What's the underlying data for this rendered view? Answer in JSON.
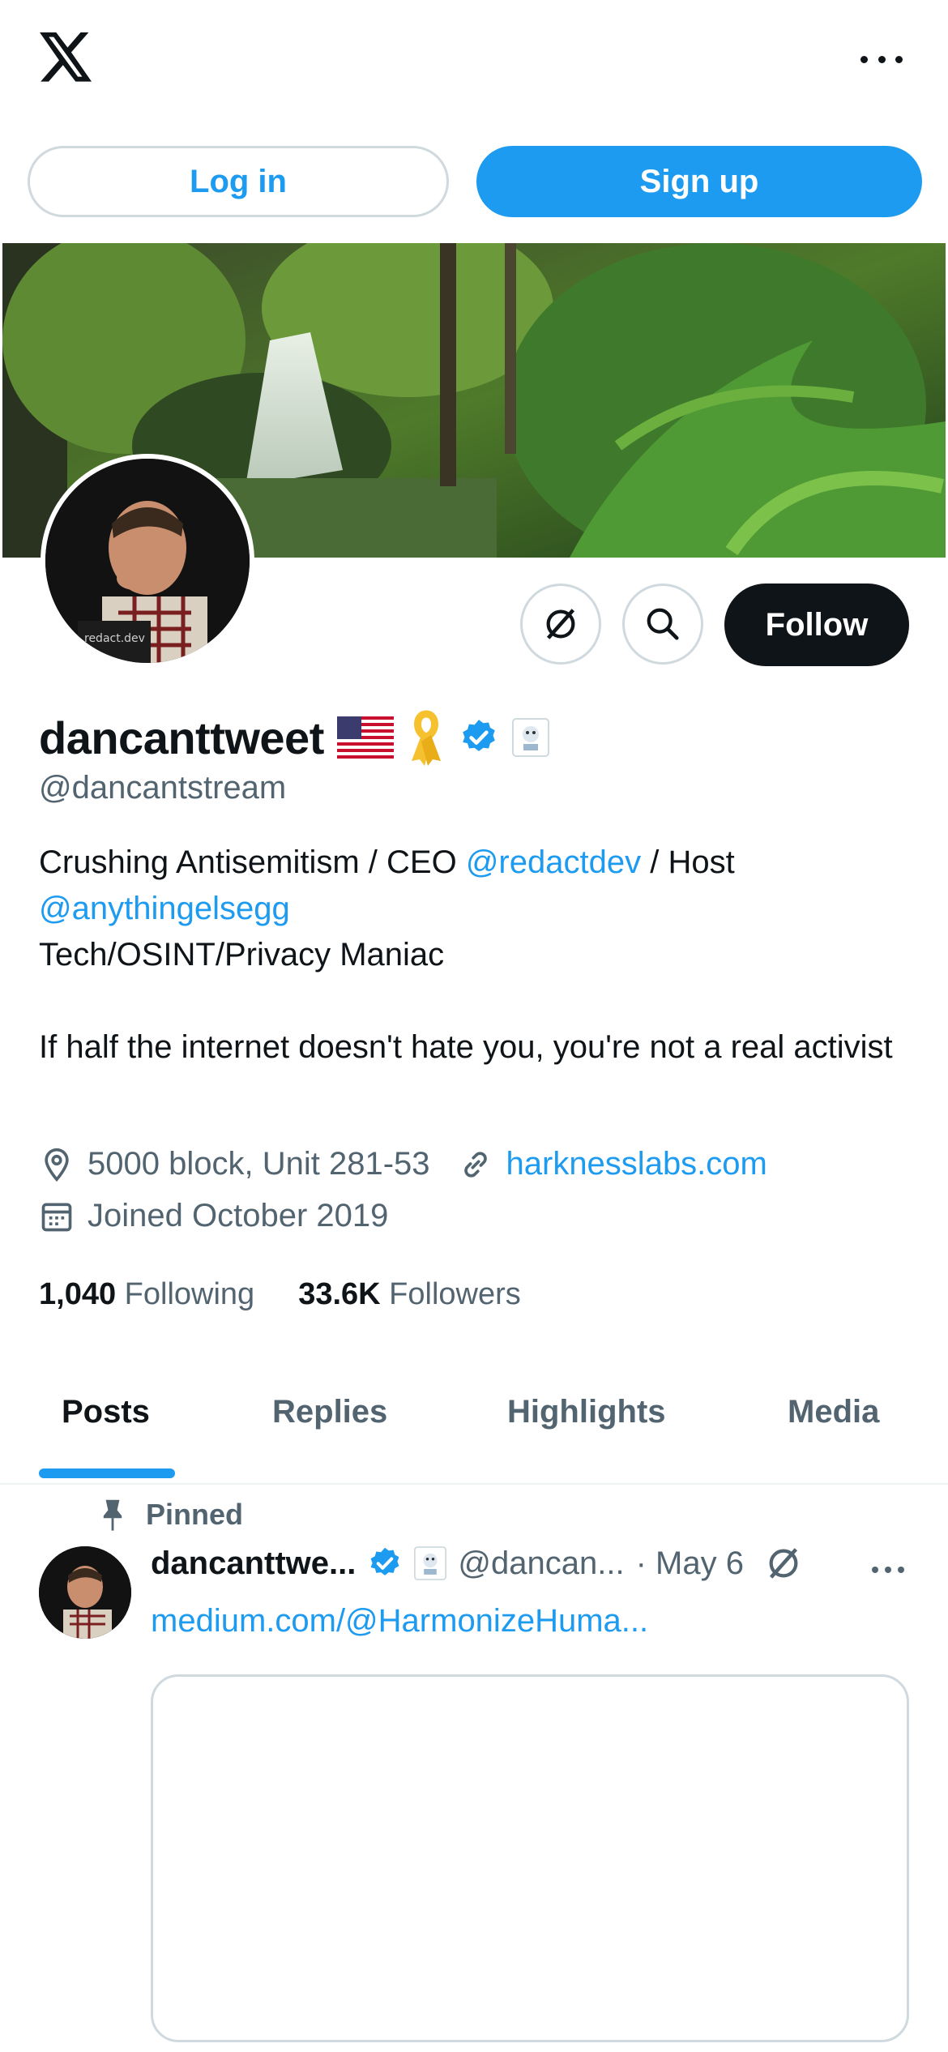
{
  "auth": {
    "login_label": "Log in",
    "signup_label": "Sign up"
  },
  "profile": {
    "display_name": "dancanttweet",
    "handle": "@dancantstream",
    "follow_label": "Follow",
    "bio": {
      "line1_a": "Crushing Antisemitism / CEO ",
      "line1_link": "@redactdev",
      "line1_b": " / Host",
      "line2_link": "@anythingelsegg",
      "line3": "Tech/OSINT/Privacy Maniac",
      "line4": "If half the internet doesn't hate you, you're not a real activist"
    },
    "location": "5000 block, Unit 281-53",
    "website": "harknesslabs.com",
    "joined": "Joined October 2019",
    "following_count": "1,040",
    "following_label": "Following",
    "followers_count": "33.6K",
    "followers_label": "Followers",
    "avatar_caption": "redact.dev"
  },
  "tabs": [
    "Posts",
    "Replies",
    "Highlights",
    "Media"
  ],
  "pinned_post": {
    "pinned_label": "Pinned",
    "name": "dancanttwe...",
    "handle": "@dancan...",
    "date": "· May 6",
    "link_text": "medium.com/@HarmonizeHuma..."
  },
  "colors": {
    "accent": "#1d9bf0",
    "text": "#0f1419",
    "muted": "#536471",
    "border": "#cfd9de"
  },
  "icons": [
    "x-logo-icon",
    "more-icon",
    "grok-icon",
    "search-icon",
    "verified-badge-icon",
    "us-flag-icon",
    "yellow-ribbon-icon",
    "affiliate-badge-icon",
    "location-icon",
    "link-icon",
    "calendar-icon",
    "pin-icon"
  ]
}
